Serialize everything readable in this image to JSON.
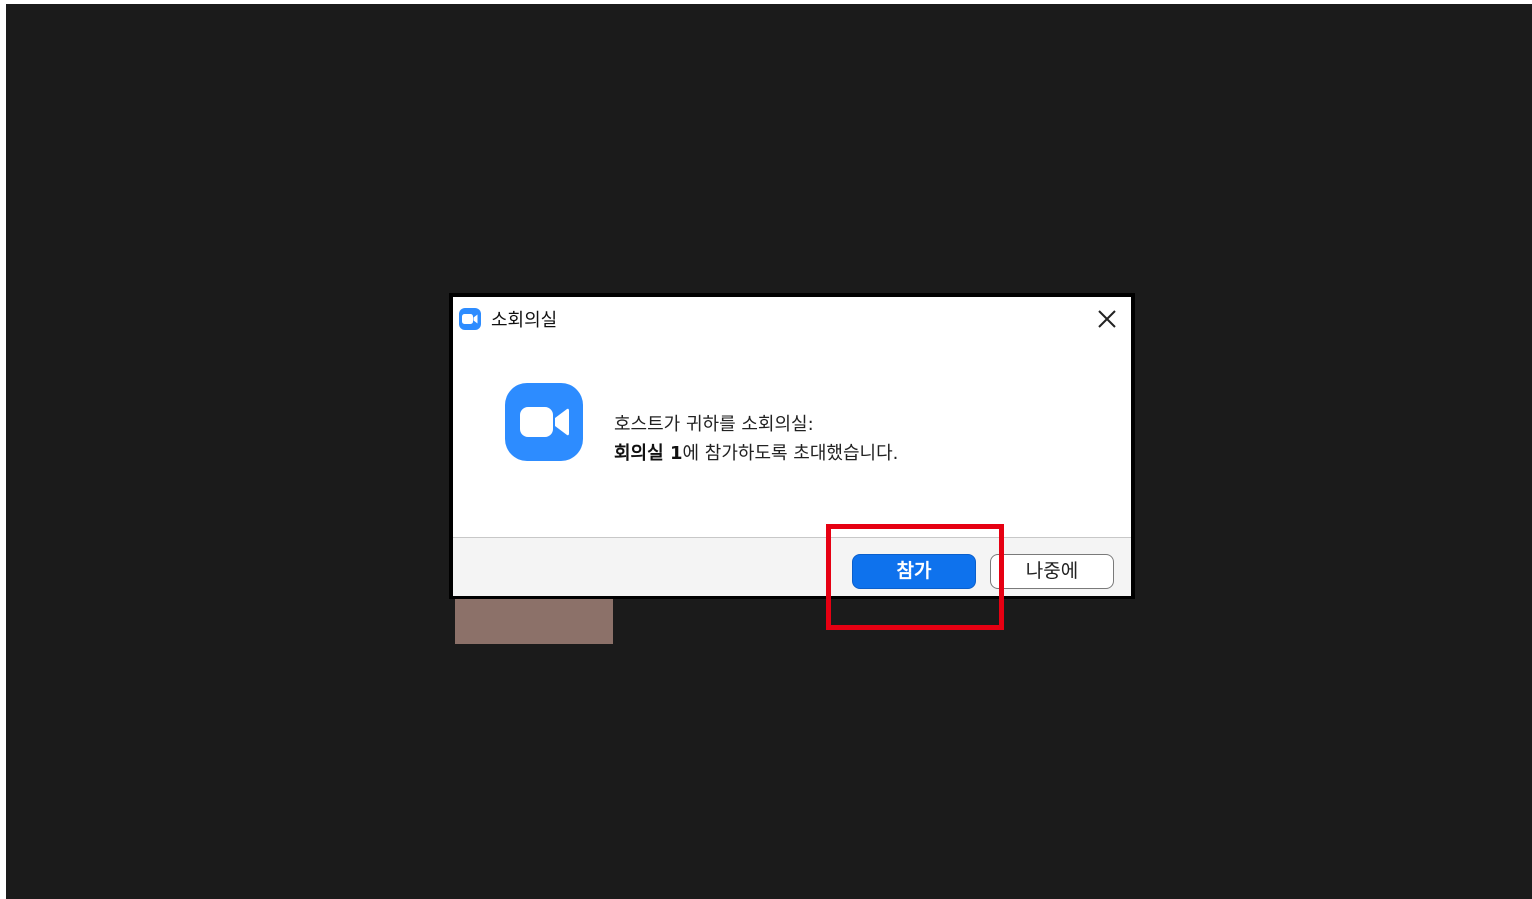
{
  "dialog": {
    "title": "소회의실",
    "message_line1": "호스트가 귀하를 소회의실:",
    "message_room": "회의실 1",
    "message_line2_rest": "에 참가하도록 초대했습니다.",
    "join_label": "참가",
    "later_label": "나중에"
  },
  "colors": {
    "brand_blue": "#2d8cff",
    "join_button": "#0e72ed",
    "highlight_box": "#e60012",
    "background": "#1b1b1b"
  },
  "icons": {
    "title": "zoom-camera-icon",
    "main": "zoom-camera-icon",
    "close": "close-icon"
  }
}
